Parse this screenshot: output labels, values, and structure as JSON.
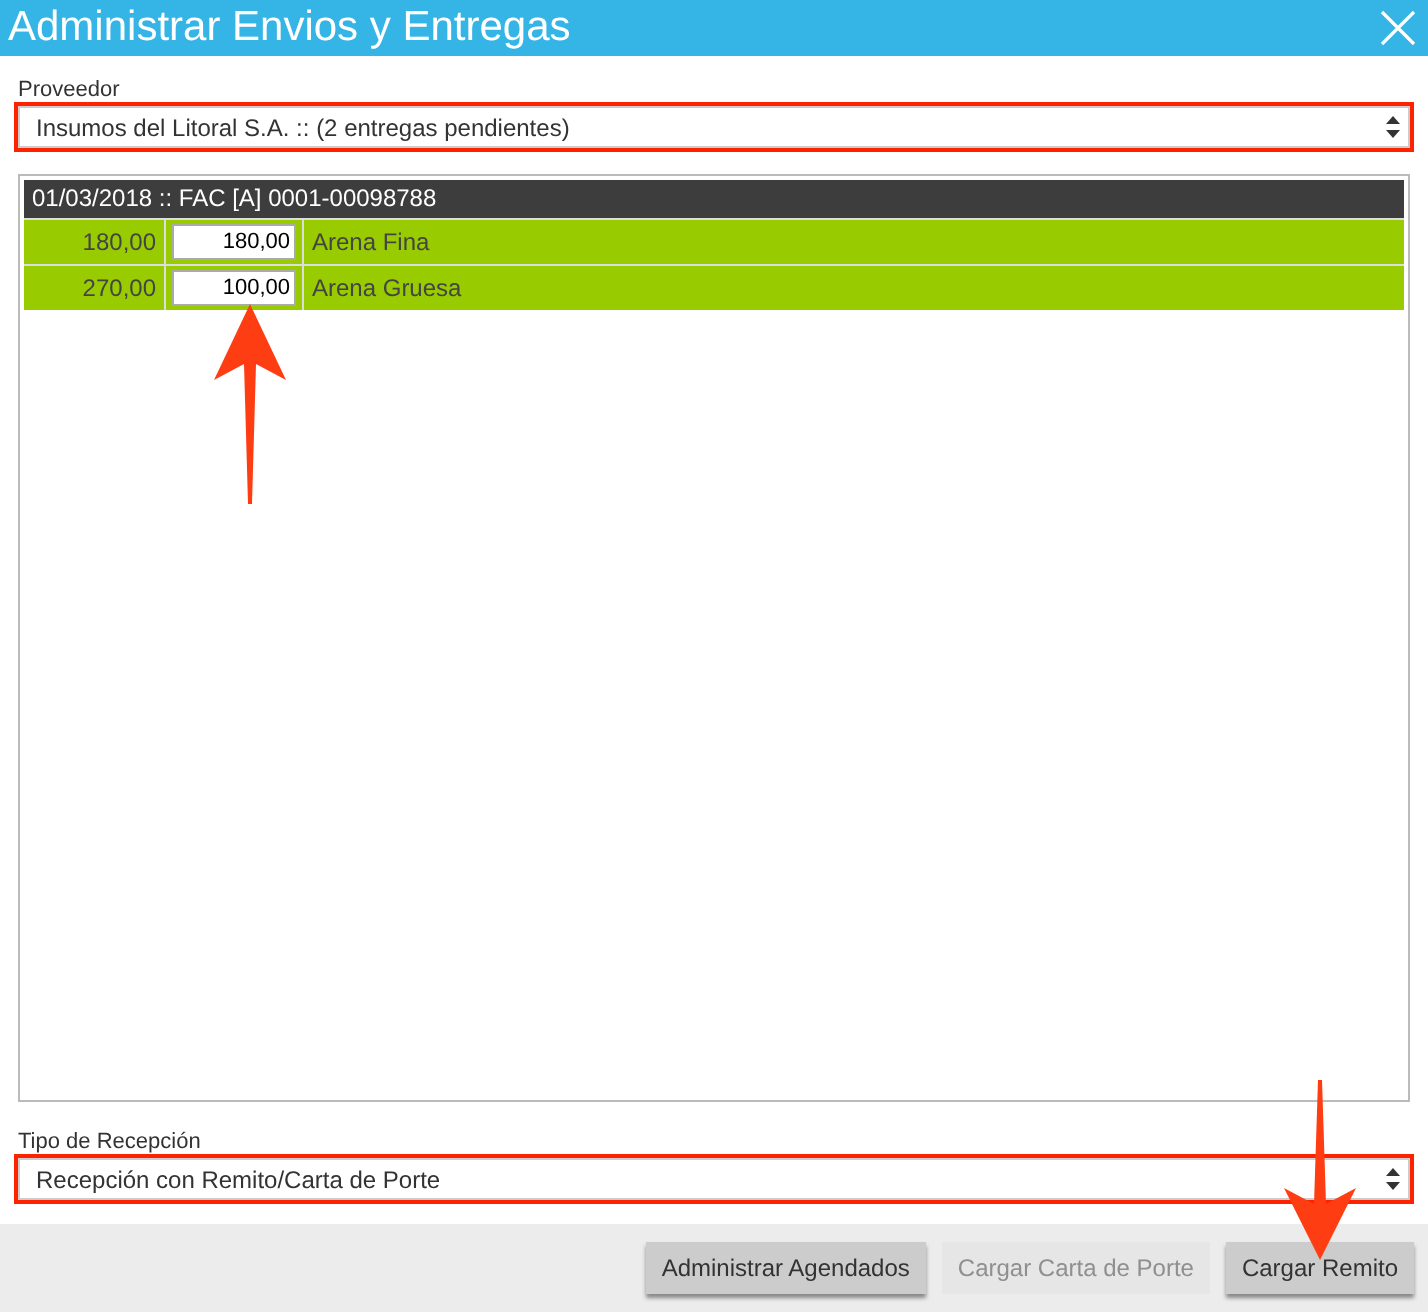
{
  "window": {
    "title": "Administrar Envios y Entregas"
  },
  "provider": {
    "label": "Proveedor",
    "value": "Insumos del Litoral S.A. :: (2 entregas pendientes)"
  },
  "invoice": {
    "header": "01/03/2018 :: FAC [A] 0001-00098788",
    "rows": [
      {
        "quantity": "180,00",
        "received": "180,00",
        "product": "Arena Fina"
      },
      {
        "quantity": "270,00",
        "received": "100,00",
        "product": "Arena Gruesa"
      }
    ]
  },
  "reception": {
    "label": "Tipo de Recepción",
    "value": "Recepción con Remito/Carta de Porte"
  },
  "buttons": [
    {
      "label": "Administrar Agendados",
      "disabled": false
    },
    {
      "label": "Cargar Carta de Porte",
      "disabled": true
    },
    {
      "label": "Cargar Remito",
      "disabled": false
    }
  ]
}
